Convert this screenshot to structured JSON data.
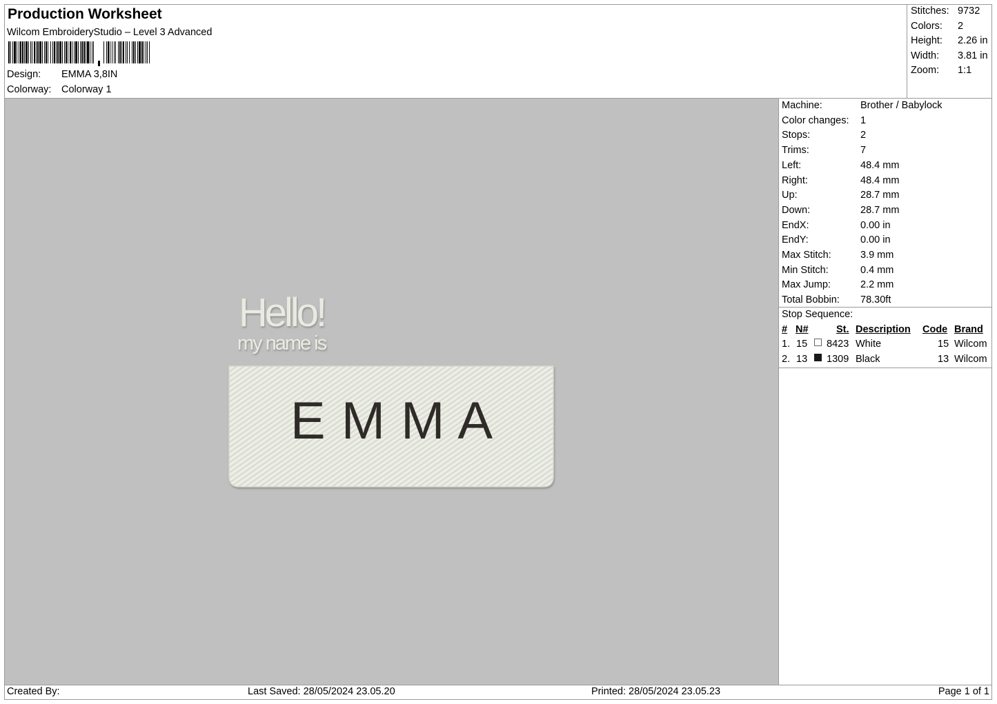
{
  "header": {
    "title": "Production Worksheet",
    "subtitle": "Wilcom EmbroideryStudio – Level 3 Advanced",
    "design_label": "Design:",
    "design_value": "EMMA 3,8IN",
    "colorway_label": "Colorway:",
    "colorway_value": "Colorway 1"
  },
  "summary": [
    {
      "label": "Stitches:",
      "value": "9732"
    },
    {
      "label": "Colors:",
      "value": "2"
    },
    {
      "label": "Height:",
      "value": "2.26 in"
    },
    {
      "label": "Width:",
      "value": "3.81 in"
    },
    {
      "label": "Zoom:",
      "value": "1:1"
    }
  ],
  "design": {
    "hello": "Hello!",
    "tagline": "my name is",
    "name": "E M M A",
    "thread_light": "#e9ebe2",
    "thread_dark": "#2e2b28",
    "background": "#c0c0c0"
  },
  "details": [
    {
      "label": "Machine:",
      "value": "Brother / Babylock"
    },
    {
      "label": "Color changes:",
      "value": "1"
    },
    {
      "label": "Stops:",
      "value": "2"
    },
    {
      "label": "Trims:",
      "value": "7"
    },
    {
      "label": "Left:",
      "value": "48.4 mm"
    },
    {
      "label": "Right:",
      "value": "48.4 mm"
    },
    {
      "label": "Up:",
      "value": "28.7 mm"
    },
    {
      "label": "Down:",
      "value": "28.7 mm"
    },
    {
      "label": "EndX:",
      "value": "0.00 in"
    },
    {
      "label": "EndY:",
      "value": "0.00 in"
    },
    {
      "label": "Max Stitch:",
      "value": "3.9 mm"
    },
    {
      "label": "Min Stitch:",
      "value": "0.4 mm"
    },
    {
      "label": "Max Jump:",
      "value": "2.2 mm"
    },
    {
      "label": "Total Bobbin:",
      "value": "78.30ft"
    }
  ],
  "stop_sequence": {
    "title": "Stop Sequence:",
    "headers": {
      "num": "#",
      "n": "N#",
      "st": "St.",
      "description": "Description",
      "code": "Code",
      "brand": "Brand"
    },
    "rows": [
      {
        "num": "1.",
        "n": "15",
        "swatch": "#ffffff",
        "st": "8423",
        "description": "White",
        "code": "15",
        "brand": "Wilcom"
      },
      {
        "num": "2.",
        "n": "13",
        "swatch": "#1a1a1a",
        "st": "1309",
        "description": "Black",
        "code": "13",
        "brand": "Wilcom"
      }
    ]
  },
  "footer": {
    "created_by": "Created By:",
    "last_saved": "Last Saved: 28/05/2024 23.05.20",
    "printed": "Printed: 28/05/2024 23.05.23",
    "page": "Page 1 of 1"
  }
}
